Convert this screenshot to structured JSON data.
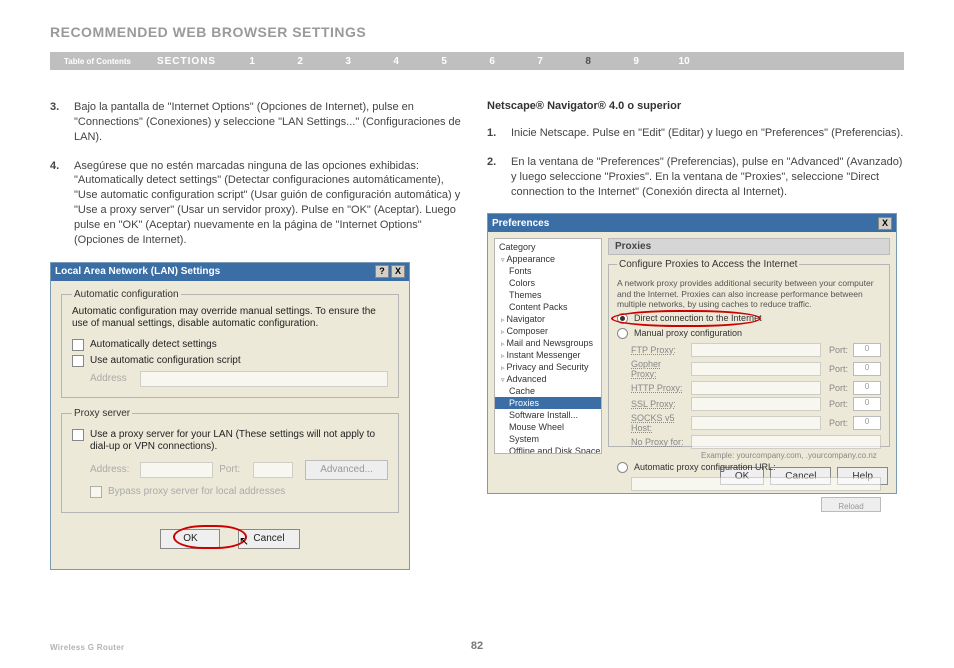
{
  "page_title": "RECOMMENDED WEB BROWSER SETTINGS",
  "nav": {
    "toc": "Table of Contents",
    "sections_label": "SECTIONS",
    "numbers": [
      "1",
      "2",
      "3",
      "4",
      "5",
      "6",
      "7",
      "8",
      "9",
      "10"
    ],
    "active_index": 7
  },
  "left": {
    "items": [
      {
        "num": "3.",
        "text": "Bajo la pantalla de \"Internet Options\" (Opciones de Internet), pulse en \"Connections\" (Conexiones) y seleccione \"LAN Settings...\" (Configuraciones de LAN)."
      },
      {
        "num": "4.",
        "text": "Asegúrese que no estén marcadas ninguna de las opciones exhibidas: \"Automatically detect settings\" (Detectar configuraciones automáticamente), \"Use automatic configuration script\" (Usar guión de configuración automática) y \"Use a proxy server\" (Usar un servidor proxy). Pulse en \"OK\" (Aceptar). Luego pulse en \"OK\" (Aceptar) nuevamente en la página de \"Internet Options\" (Opciones de Internet)."
      }
    ]
  },
  "lan_dialog": {
    "title": "Local Area Network (LAN) Settings",
    "help_btn": "?",
    "close_btn": "X",
    "group_auto": {
      "legend": "Automatic configuration",
      "note": "Automatic configuration may override manual settings.  To ensure the use of manual settings, disable automatic configuration.",
      "chk_detect": "Automatically detect settings",
      "chk_script": "Use automatic configuration script",
      "addr_label": "Address"
    },
    "group_proxy": {
      "legend": "Proxy server",
      "chk_use": "Use a proxy server for your LAN (These settings will not apply to dial-up or VPN connections).",
      "addr_label": "Address:",
      "port_label": "Port:",
      "advanced_btn": "Advanced...",
      "chk_bypass": "Bypass proxy server for local addresses"
    },
    "ok": "OK",
    "cancel": "Cancel"
  },
  "right": {
    "title": "Netscape® Navigator® 4.0 o superior",
    "items": [
      {
        "num": "1.",
        "text": "Inicie Netscape. Pulse en \"Edit\" (Editar) y luego en \"Preferences\" (Preferencias)."
      },
      {
        "num": "2.",
        "text": "En la ventana de \"Preferences\" (Preferencias), pulse en \"Advanced\" (Avanzado) y luego seleccione \"Proxies\". En la ventana de \"Proxies\", seleccione \"Direct connection to the Internet\" (Conexión directa al Internet)."
      }
    ]
  },
  "pref_dialog": {
    "title": "Preferences",
    "close_btn": "X",
    "side_header": "Category",
    "tree": {
      "appearance": "Appearance",
      "fonts": "Fonts",
      "colors": "Colors",
      "themes": "Themes",
      "content_packs": "Content Packs",
      "navigator": "Navigator",
      "composer": "Composer",
      "mail": "Mail and Newsgroups",
      "im": "Instant Messenger",
      "privacy": "Privacy and Security",
      "advanced": "Advanced",
      "cache": "Cache",
      "proxies": "Proxies",
      "software": "Software Install...",
      "mouse": "Mouse Wheel",
      "system": "System",
      "offline": "Offline and Disk Space"
    },
    "pane": {
      "title": "Proxies",
      "legend": "Configure Proxies to Access the Internet",
      "note": "A network proxy provides additional security between your computer and the Internet. Proxies can also increase performance between multiple networks, by using caches to reduce traffic.",
      "opt_direct": "Direct connection to the Internet",
      "opt_manual": "Manual proxy configuration",
      "rows": {
        "ftp": "FTP Proxy:",
        "gopher": "Gopher Proxy:",
        "http": "HTTP Proxy:",
        "ssl": "SSL Proxy:",
        "socks": "SOCKS v5 Host:",
        "noproxy": "No Proxy for:"
      },
      "port": "Port:",
      "port_val": "0",
      "example": "Example: yourcompany.com, .yourcompany.co.nz",
      "opt_auto": "Automatic proxy configuration URL:",
      "reload": "Reload"
    },
    "ok": "OK",
    "cancel": "Cancel",
    "help": "Help"
  },
  "footer": {
    "product": "Wireless G Router",
    "page": "82"
  }
}
